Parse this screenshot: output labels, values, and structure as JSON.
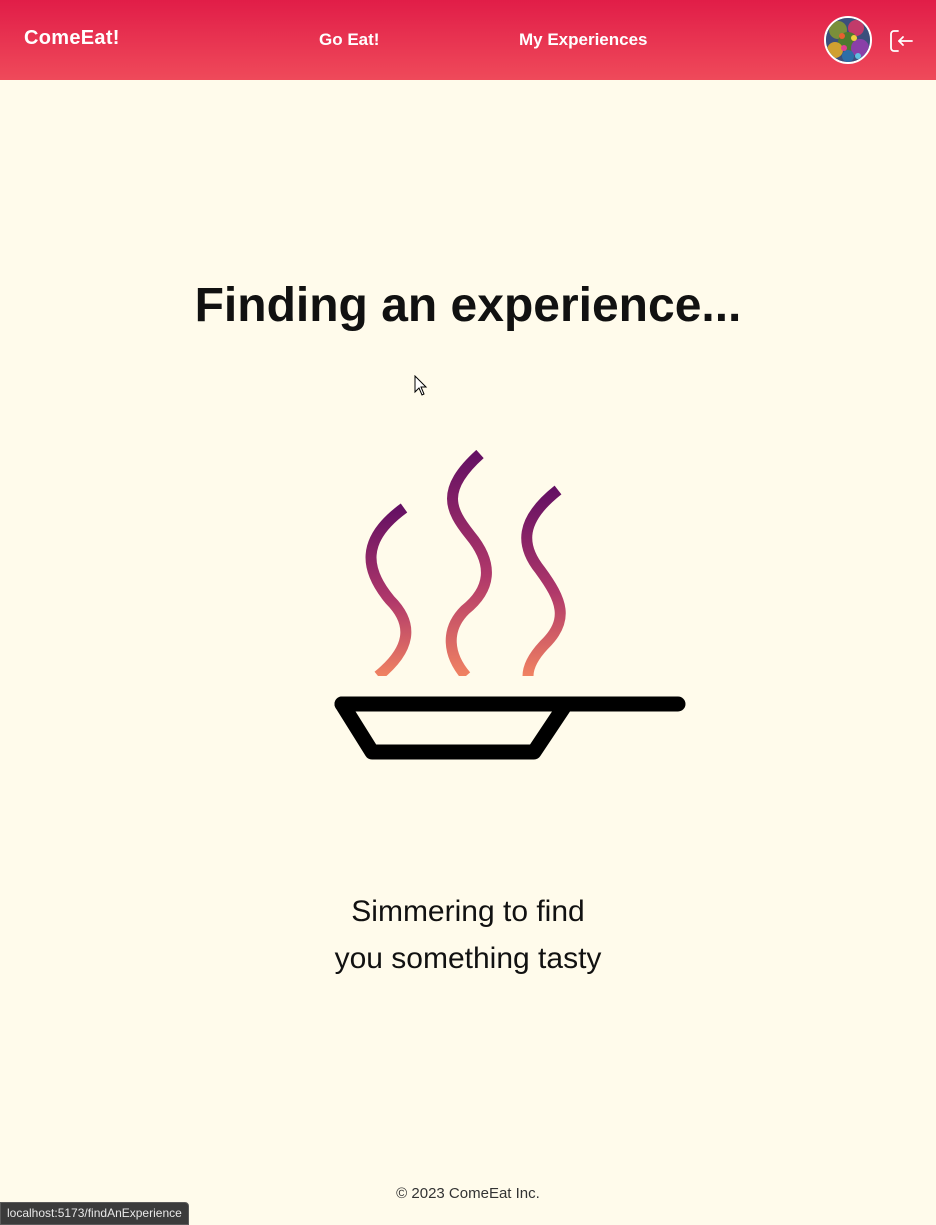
{
  "navbar": {
    "brand": "ComeEat!",
    "links": [
      {
        "label": "Go Eat!"
      },
      {
        "label": "My Experiences"
      }
    ],
    "avatar_icon": "user-avatar",
    "logout_icon": "logout-icon"
  },
  "main": {
    "headline": "Finding an experience...",
    "caption_line1": "Simmering to find",
    "caption_line2": "you something tasty",
    "illustration_icon": "steaming-pan-icon"
  },
  "footer": {
    "text": "© 2023 ComeEat Inc."
  },
  "status_bar": {
    "url": "localhost:5173/findAnExperience"
  },
  "colors": {
    "accent": "#e11d48",
    "background": "#fffbeb",
    "steam_top": "#6b1060",
    "steam_bottom": "#f07a62"
  }
}
